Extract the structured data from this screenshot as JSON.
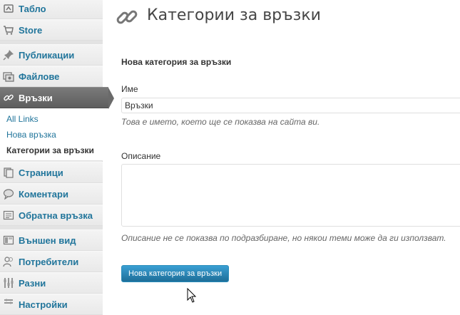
{
  "sidebar": {
    "items": [
      {
        "label": "Табло",
        "icon": "dashboard-icon"
      },
      {
        "label": "Store",
        "icon": "cart-icon"
      },
      {
        "label": "Публикации",
        "icon": "pin-icon"
      },
      {
        "label": "Файлове",
        "icon": "media-icon"
      },
      {
        "label": "Връзки",
        "icon": "link-icon",
        "active": true
      },
      {
        "label": "Страници",
        "icon": "pages-icon"
      },
      {
        "label": "Коментари",
        "icon": "comments-icon"
      },
      {
        "label": "Обратна връзка",
        "icon": "feedback-icon"
      },
      {
        "label": "Външен вид",
        "icon": "appearance-icon"
      },
      {
        "label": "Потребители",
        "icon": "users-icon"
      },
      {
        "label": "Разни",
        "icon": "tools-icon"
      },
      {
        "label": "Настройки",
        "icon": "settings-icon"
      }
    ],
    "submenu": [
      {
        "label": "All Links"
      },
      {
        "label": "Нова връзка"
      },
      {
        "label": "Категории за връзки",
        "current": true
      }
    ]
  },
  "main": {
    "title": "Категории за връзки",
    "form_title": "Нова категория за връзки",
    "name_label": "Име",
    "name_value": "Връзки",
    "name_hint": "Това е името, което ще се показва на сайта ви.",
    "description_label": "Описание",
    "description_value": "",
    "description_hint": "Описание не се показва по подразбиране, но някои теми може да ги използват.",
    "submit_label": "Нова категория за връзки"
  },
  "colors": {
    "link": "#21759b",
    "active_menu": "#6a6a6a",
    "button": "#21759b",
    "sidebar_bg": "#ececec"
  }
}
